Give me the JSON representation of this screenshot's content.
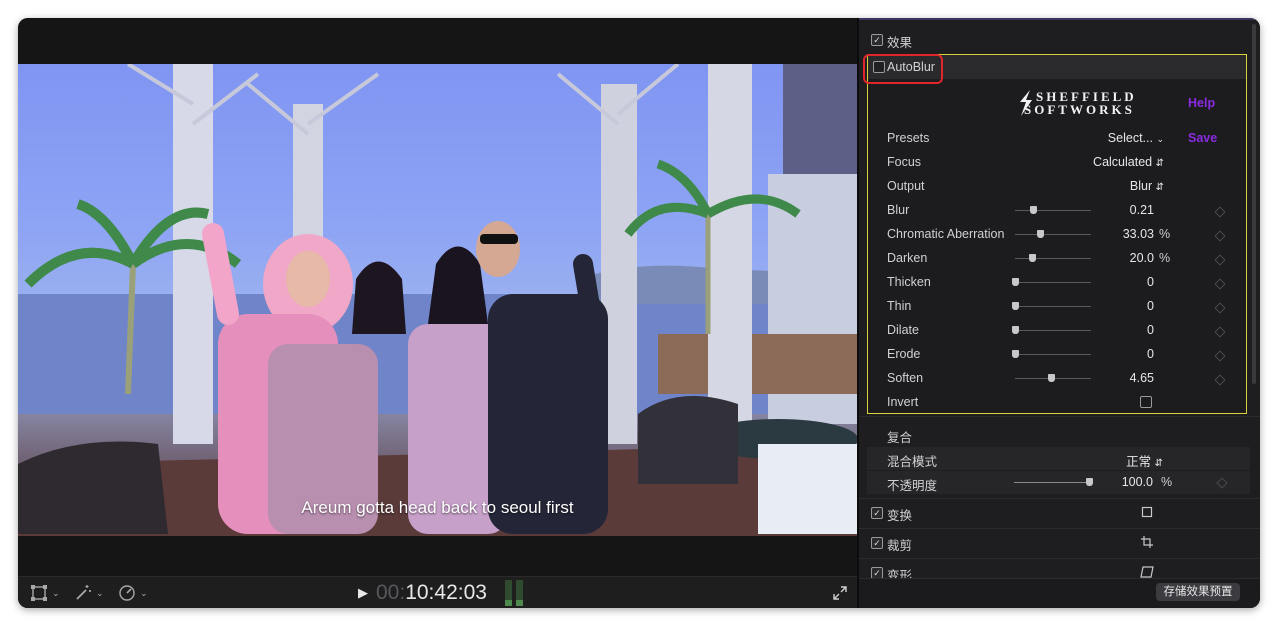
{
  "viewer": {
    "subtitle": "Areum gotta head back to seoul first",
    "timecode_dim": "00:",
    "timecode": "10:42:03",
    "play_icon": "play-icon",
    "tools": [
      "transform-icon",
      "magic-wand-icon",
      "speed-icon"
    ],
    "fullscreen_icon": "fullscreen-icon"
  },
  "inspector": {
    "effects_label": "效果",
    "plugin": {
      "name": "AutoBlur",
      "logo_line1": "SHEFFIELD",
      "logo_line2": "SOFTWORKS",
      "help": "Help",
      "save": "Save",
      "presets_label": "Presets",
      "presets_value": "Select...",
      "focus_label": "Focus",
      "focus_value": "Calculated",
      "output_label": "Output",
      "output_value": "Blur",
      "params": [
        {
          "label": "Blur",
          "value": "0.21",
          "unit": "",
          "level": 0.24
        },
        {
          "label": "Chromatic Aberration",
          "value": "33.03",
          "unit": "%",
          "level": 0.33
        },
        {
          "label": "Darken",
          "value": "20.0",
          "unit": "%",
          "level": 0.22
        },
        {
          "label": "Thicken",
          "value": "0",
          "unit": "",
          "level": 0.0
        },
        {
          "label": "Thin",
          "value": "0",
          "unit": "",
          "level": 0.0
        },
        {
          "label": "Dilate",
          "value": "0",
          "unit": "",
          "level": 0.0
        },
        {
          "label": "Erode",
          "value": "0",
          "unit": "",
          "level": 0.0
        },
        {
          "label": "Soften",
          "value": "4.65",
          "unit": "",
          "level": 0.47
        }
      ],
      "invert_label": "Invert"
    },
    "composite_label": "复合",
    "blend_label": "混合模式",
    "blend_value": "正常",
    "opacity_label": "不透明度",
    "opacity_value": "100.0",
    "opacity_unit": "%",
    "opacity_level": 1.0,
    "sections": [
      {
        "label": "变换",
        "icon": "transform-box-icon"
      },
      {
        "label": "裁剪",
        "icon": "crop-icon"
      },
      {
        "label": "变形",
        "icon": "distort-icon"
      }
    ],
    "save_preset_button": "存储效果预置"
  }
}
